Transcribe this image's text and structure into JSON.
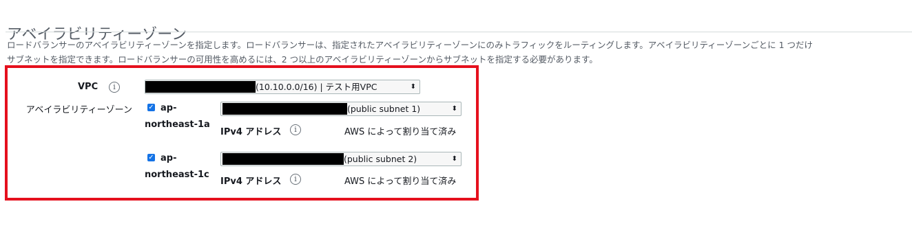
{
  "section": {
    "title": "アベイラビリティーゾーン",
    "description_line1": "ロードバランサーのアベイラビリティーゾーンを指定します。ロードバランサーは、指定されたアベイラビリティーゾーンにのみトラフィックをルーティングします。アベイラビリティーゾーンごとに 1 つだけ",
    "description_line2": "サブネットを指定できます。ロードバランサーの可用性を高めるには、2 つ以上のアベイラビリティーゾーンからサブネットを指定する必要があります。"
  },
  "vpc": {
    "label": "VPC",
    "info": "i",
    "selected_value": "(10.10.0.0/16) | テスト用VPC"
  },
  "availability_zones": {
    "label": "アベイラビリティーゾーン",
    "zones": [
      {
        "name_line1": "ap-",
        "name_line2": "northeast-1a",
        "checked": true,
        "subnet_value": "(public subnet 1)",
        "ipv4_label": "IPv4 アドレス",
        "info": "i",
        "ipv4_value": "AWS によって割り当て済み"
      },
      {
        "name_line1": "ap-",
        "name_line2": "northeast-1c",
        "checked": true,
        "subnet_value": "(public subnet 2)",
        "ipv4_label": "IPv4 アドレス",
        "info": "i",
        "ipv4_value": "AWS によって割り当て済み"
      }
    ]
  },
  "icons": {
    "checkbox_checked": "check-icon",
    "select_arrow": "up-down-arrow-icon",
    "info": "info-icon"
  },
  "colors": {
    "highlight_border": "#e5101d",
    "checkbox": "#1473e6",
    "redaction": "#000000"
  }
}
